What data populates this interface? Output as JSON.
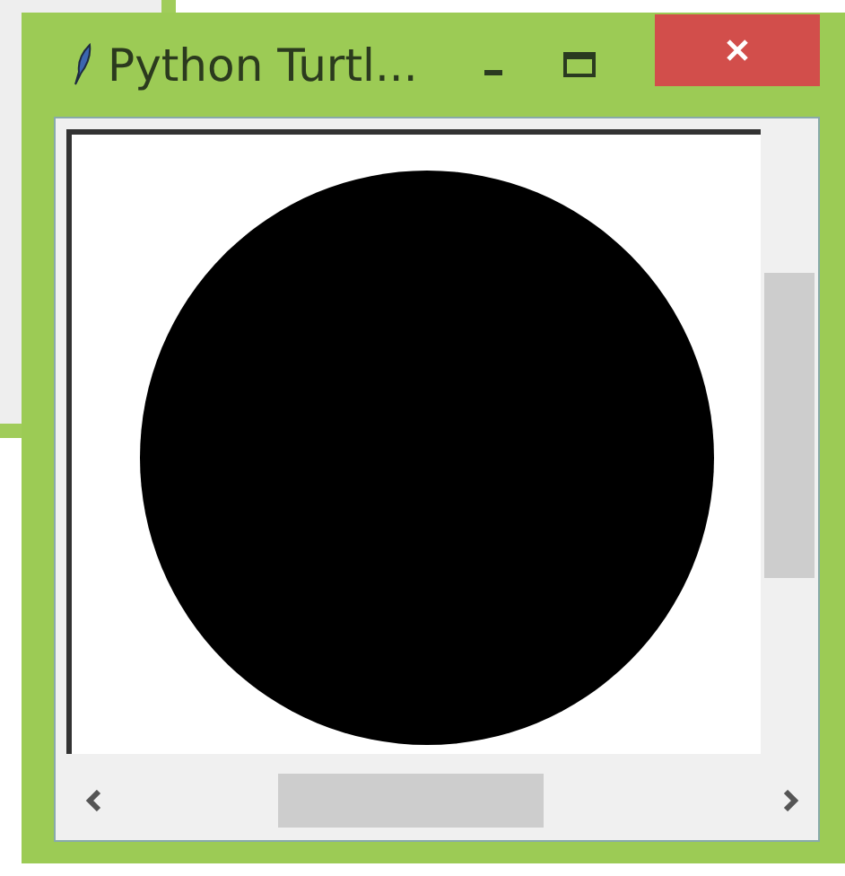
{
  "window": {
    "title": "Python Turtl..."
  }
}
